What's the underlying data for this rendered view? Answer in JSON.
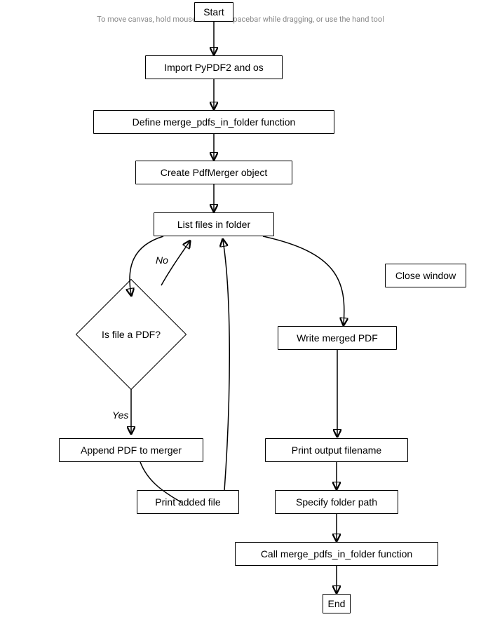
{
  "hint": "To move canvas, hold mouse wheel or spacebar while dragging, or use the hand tool",
  "nodes": {
    "start": "Start",
    "import": "Import PyPDF2 and os",
    "define": "Define merge_pdfs_in_folder function",
    "create": "Create PdfMerger object",
    "list": "List files in folder",
    "decision": "Is file a PDF?",
    "append": "Append PDF to merger",
    "printAdded": "Print added file",
    "write": "Write merged PDF",
    "printOutput": "Print output filename",
    "specify": "Specify folder path",
    "call": "Call merge_pdfs_in_folder function",
    "end": "End",
    "closeWindow": "Close window"
  },
  "edges": {
    "yes": "Yes",
    "no": "No"
  }
}
